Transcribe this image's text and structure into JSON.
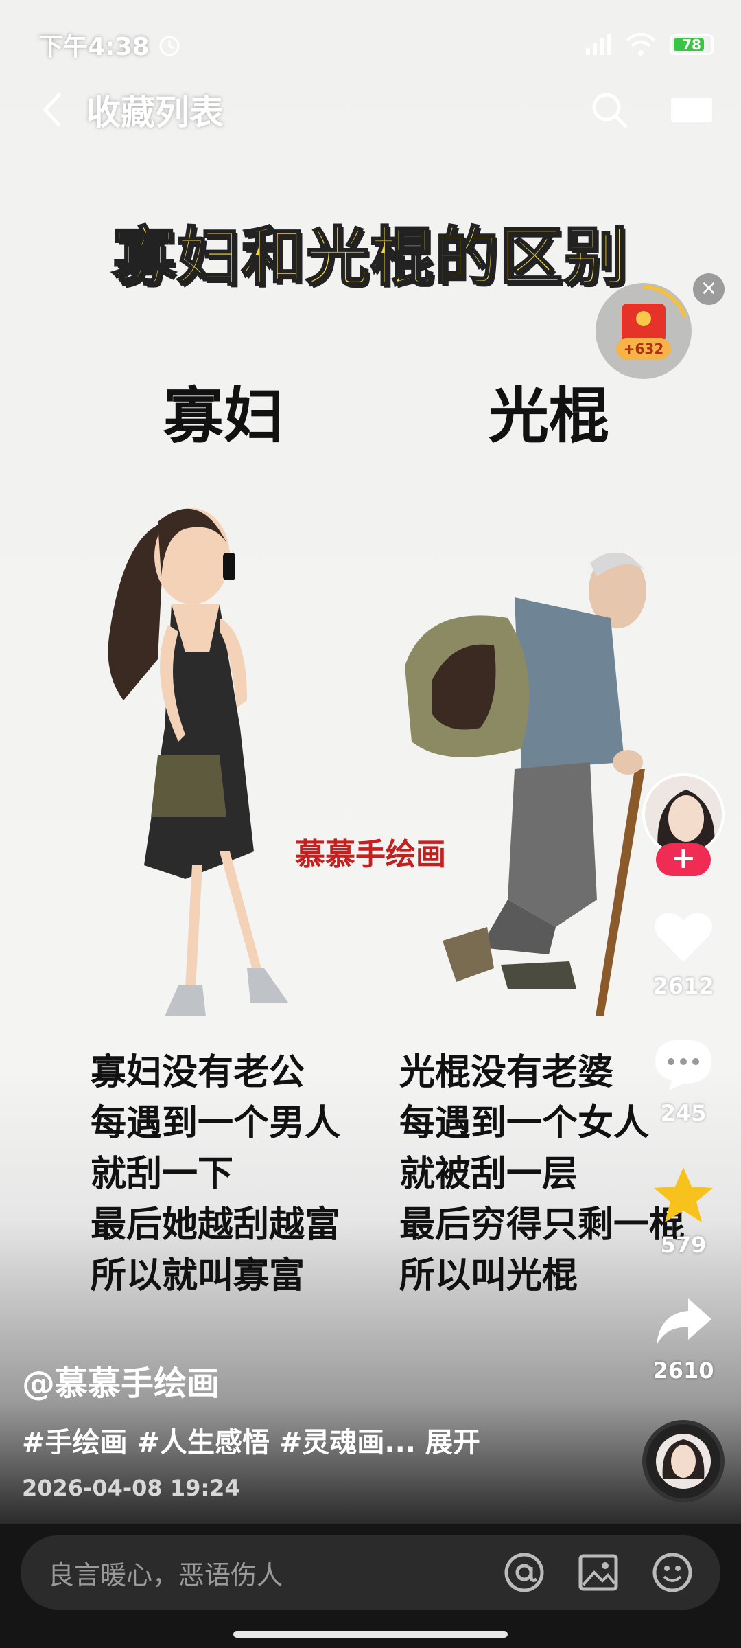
{
  "status_bar": {
    "time": "下午4:38",
    "battery": "78"
  },
  "header": {
    "title": "收藏列表"
  },
  "poster": {
    "title": "寡妇和光棍的区别",
    "left_heading": "寡妇",
    "right_heading": "光棍",
    "watermark": "慕慕手绘画",
    "left_lines": [
      "寡妇没有老公",
      "每遇到一个男人",
      "就刮一下",
      "最后她越刮越富",
      "所以就叫寡富"
    ],
    "right_lines": [
      "光棍没有老婆",
      "每遇到一个女人",
      "就被刮一层",
      "最后穷得只剩一棍",
      "所以叫光棍"
    ]
  },
  "red_packet": {
    "amount": "+632"
  },
  "actions": {
    "likes": "2612",
    "comments": "245",
    "favorites": "579",
    "shares": "2610"
  },
  "caption": {
    "author": "@慕慕手绘画",
    "tags": "#手绘画 #人生感悟 #灵魂画... 展开",
    "date": "2026-04-08 19:24"
  },
  "comment_bar": {
    "placeholder": "良言暖心，恶语伤人"
  },
  "colors": {
    "accent_red": "#f02c55",
    "title_yellow": "#f5d838",
    "watermark_red": "#c42020"
  }
}
